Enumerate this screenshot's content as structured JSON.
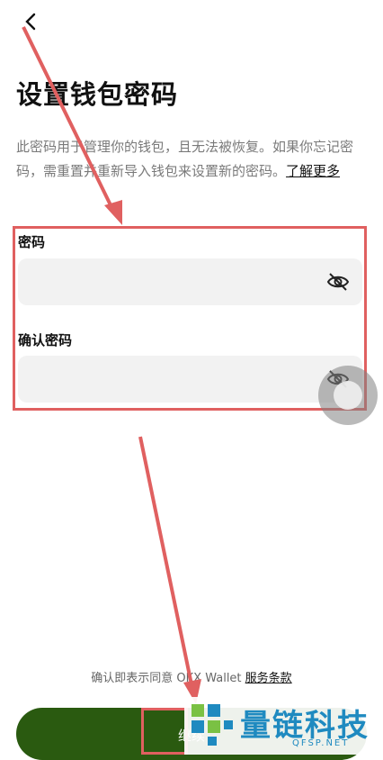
{
  "header": {
    "back_icon": "chevron-left-icon"
  },
  "title": "设置钱包密码",
  "description": {
    "text": "此密码用于管理你的钱包，且无法被恢复。如果你忘记密码，需重置并重新导入钱包来设置新的密码。",
    "link": "了解更多"
  },
  "form": {
    "password_label": "密码",
    "confirm_label": "确认密码",
    "visibility_icon": "eye-off-icon"
  },
  "terms": {
    "text": "确认即表示同意 OKX Wallet ",
    "link": "服务条款"
  },
  "cta": {
    "label": "继续"
  },
  "watermark": {
    "name": "量链科技",
    "url": "QFSP.NET"
  },
  "colors": {
    "annotation": "#e06060",
    "cta": "#2a5a10",
    "watermark": "#1f8ac0"
  }
}
